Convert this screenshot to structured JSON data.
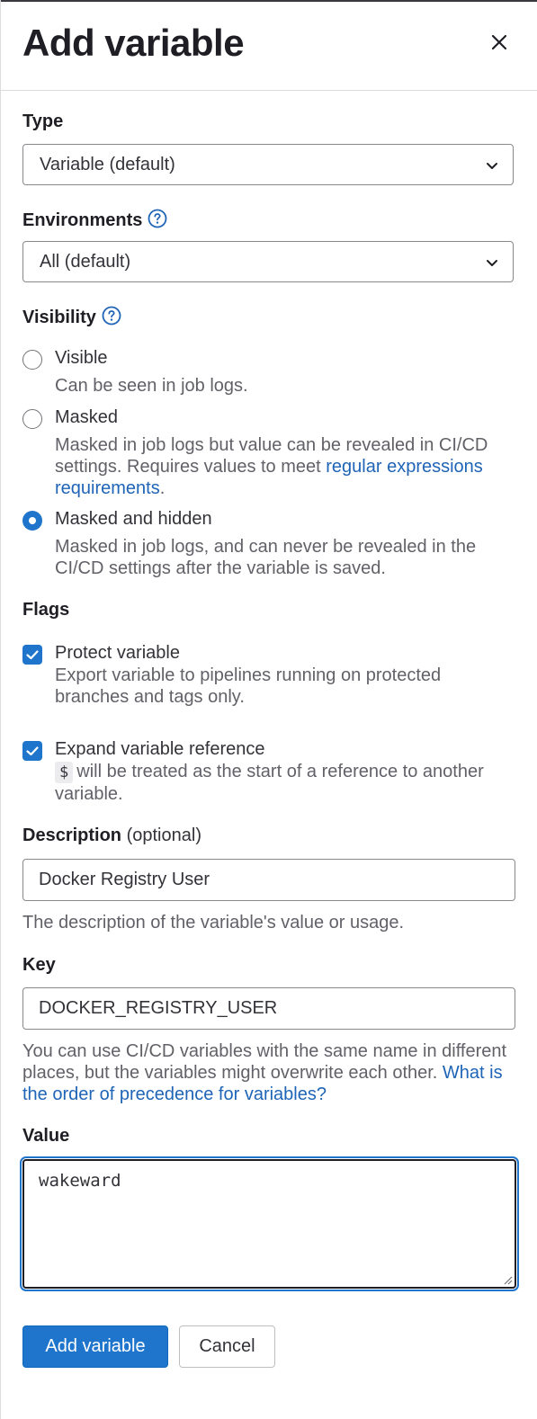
{
  "drawer": {
    "title": "Add variable",
    "close_icon": "close-icon"
  },
  "type": {
    "label": "Type",
    "selected": "Variable (default)"
  },
  "environments": {
    "label": "Environments",
    "selected": "All (default)"
  },
  "visibility": {
    "label": "Visibility",
    "options": [
      {
        "label": "Visible",
        "help": "Can be seen in job logs.",
        "selected": false
      },
      {
        "label": "Masked",
        "help_prefix": "Masked in job logs but value can be revealed in CI/CD settings. Requires values to meet ",
        "help_link": "regular expressions requirements",
        "help_suffix": ".",
        "selected": false
      },
      {
        "label": "Masked and hidden",
        "help": "Masked in job logs, and can never be revealed in the CI/CD settings after the variable is saved.",
        "selected": true
      }
    ]
  },
  "flags": {
    "label": "Flags",
    "protect": {
      "label": "Protect variable",
      "help": "Export variable to pipelines running on protected branches and tags only.",
      "checked": true
    },
    "expand": {
      "label": "Expand variable reference",
      "code": "$",
      "help": "will be treated as the start of a reference to another variable.",
      "checked": true
    }
  },
  "description": {
    "label": "Description",
    "optional": "(optional)",
    "value": "Docker Registry User",
    "help": "The description of the variable's value or usage."
  },
  "key": {
    "label": "Key",
    "value": "DOCKER_REGISTRY_USER",
    "help": "You can use CI/CD variables with the same name in different places, but the variables might overwrite each other.",
    "help_link": "What is the order of precedence for variables?"
  },
  "value": {
    "label": "Value",
    "value": "wakeward"
  },
  "actions": {
    "submit": "Add variable",
    "cancel": "Cancel"
  },
  "colors": {
    "primary": "#1f75cb",
    "link": "#1f64b6",
    "text": "#333238",
    "muted": "#626168"
  }
}
